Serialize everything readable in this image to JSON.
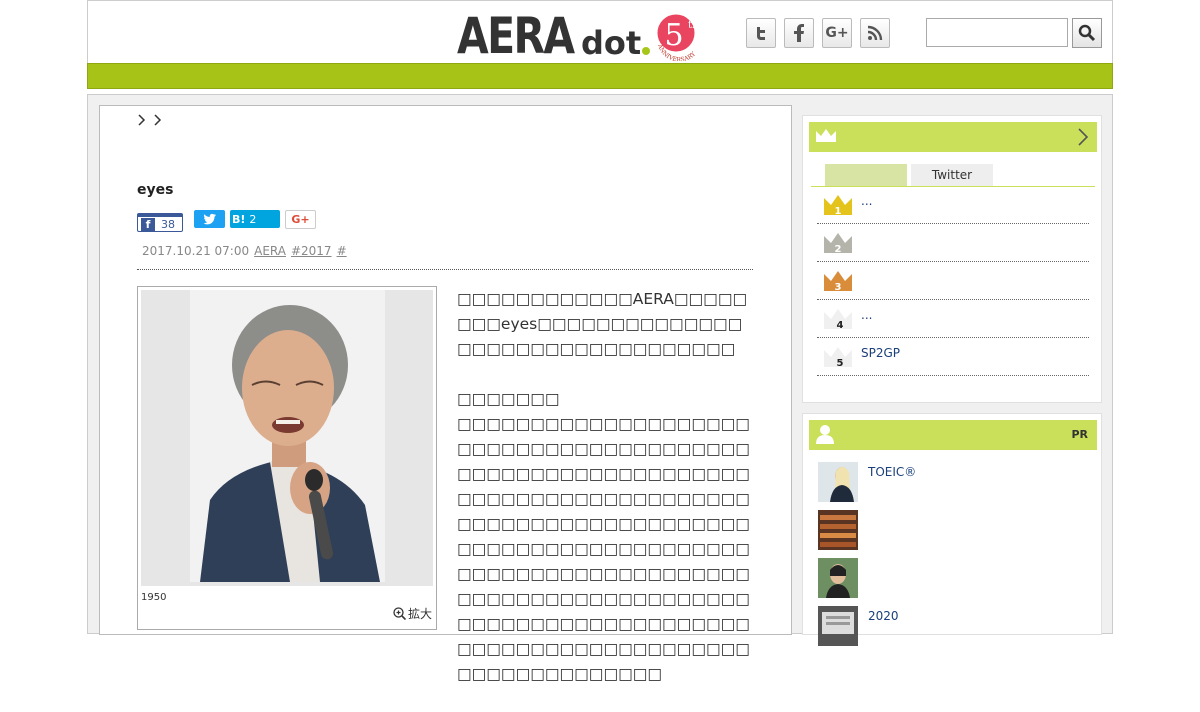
{
  "header": {
    "logo_main": "AERA",
    "logo_sub": "dot",
    "anniversary_number": "5",
    "anniversary_suffix": "th",
    "anniversary_text": "ANNIVERSARY",
    "social": [
      {
        "name": "twitter-icon",
        "glyph": "t"
      },
      {
        "name": "facebook-icon",
        "glyph": "f"
      },
      {
        "name": "google-plus-icon",
        "glyph": "G+"
      },
      {
        "name": "rss-icon",
        "glyph": "rss"
      }
    ],
    "search_placeholder": ""
  },
  "article": {
    "breadcrumb": [
      "",
      ""
    ],
    "title": "eyes",
    "share": {
      "facebook_count": "38",
      "hatena_label": "B!",
      "hatena_count": "2",
      "googleplus_label": "G+"
    },
    "meta": {
      "date": "2017.10.21 07:00",
      "source": "AERA",
      "tag1": "#2017",
      "tag2": "#"
    },
    "photo_caption": "1950",
    "zoom_label": "拡大",
    "paragraphs": [
      "□□□□□□□□□□□□AERA□□□□□□□□eyes□□□□□□□□□□□□□□□□□□□□□□□□□□□□□□□□□",
      "□□□□□□□\n□□□□□□□□□□□□□□□□□□□□□□□□□□□□□□□□□□□□□□□□□□□□□□□□□□□□□□□□□□□□□□□□□□□□□□□□□□□□□□□□□□□□□□□□□□□□□□□□□□□□□□□□□□□□□□□□□□□□□□□□□□□□□□□□□□□□□□□□□□□□□□□□□□□□□□□□□□□□□□□□□□□□□□□□□□□□□□□□□□□□□□□□□□□□□□□□□□□□□□□□□□□□□□□□□□□□□□"
    ]
  },
  "sidebar": {
    "ranking": {
      "tabs": [
        "",
        "Twitter"
      ],
      "items": [
        {
          "rank": "1",
          "text": "...",
          "color": "#e3c31c"
        },
        {
          "rank": "2",
          "text": "",
          "color": "#b4b4aa"
        },
        {
          "rank": "3",
          "text": "",
          "color": "#d98d3a"
        },
        {
          "rank": "4",
          "text": "...",
          "color": "#f2f2f2"
        },
        {
          "rank": "5",
          "text": "SP2GP",
          "color": "#f2f2f2"
        }
      ]
    },
    "pr": {
      "label": "PR",
      "items": [
        {
          "text": "TOEIC®",
          "thumb_color": "#c7d3dc"
        },
        {
          "text": "",
          "thumb_color": "#a0522d"
        },
        {
          "text": "",
          "thumb_color": "#4b6b48"
        },
        {
          "text": "2020",
          "thumb_color": "#777"
        }
      ]
    }
  },
  "colors": {
    "accent_green": "#a8c317",
    "panel_green": "#cbe05a",
    "facebook": "#3b5998",
    "twitter": "#1da1f2",
    "hatena": "#00a4de"
  }
}
